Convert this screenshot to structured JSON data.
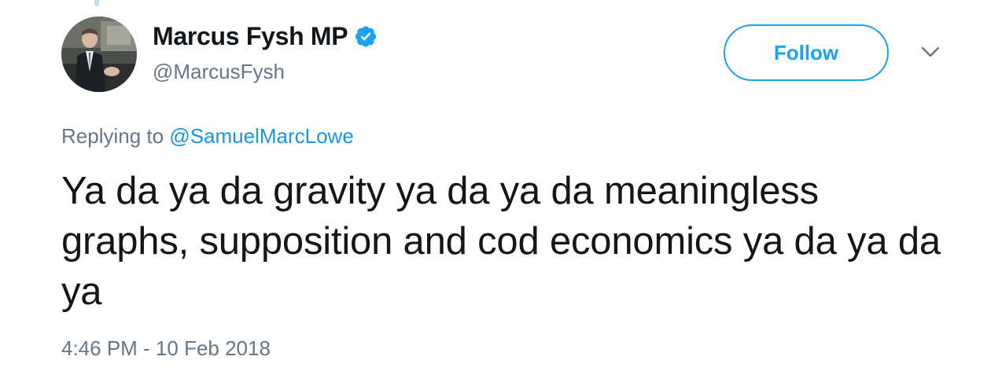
{
  "tweet": {
    "author": {
      "display_name": "Marcus Fysh MP",
      "handle": "@MarcusFysh",
      "verified": true
    },
    "follow_label": "Follow",
    "reply_prefix": "Replying to",
    "reply_to_handle": "@SamuelMarcLowe",
    "text": "Ya da ya da gravity ya da ya da meaningless graphs, supposition and cod economics ya da ya da ya",
    "timestamp": "4:46 PM - 10 Feb 2018"
  },
  "icons": {
    "verified": "verified-badge-icon",
    "menu": "chevron-down-icon"
  },
  "colors": {
    "accent": "#1da1f2",
    "link": "#1b95e0",
    "secondary_text": "#657786",
    "primary_text": "#14171a"
  }
}
